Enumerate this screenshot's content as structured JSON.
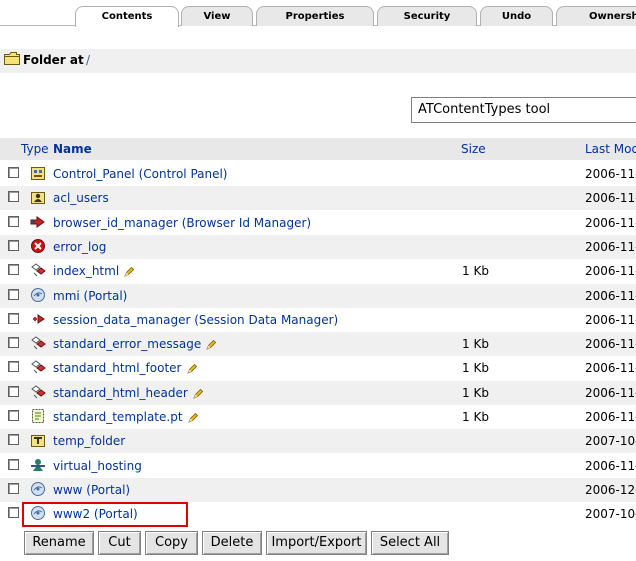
{
  "tabs": [
    {
      "label": "Contents",
      "active": true
    },
    {
      "label": "View"
    },
    {
      "label": "Properties"
    },
    {
      "label": "Security"
    },
    {
      "label": "Undo"
    },
    {
      "label": "Ownership"
    }
  ],
  "header": {
    "folder_label": "Folder at",
    "path": "/"
  },
  "add_type_select": {
    "selected": "ATContentTypes tool"
  },
  "listing": {
    "columns": {
      "type": "Type",
      "name": "Name",
      "size": "Size",
      "modified": "Last Modified"
    },
    "rows": [
      {
        "icon": "control-panel-icon",
        "name": "Control_Panel (Control Panel)",
        "editable": false,
        "size": "",
        "modified": "2006-11-"
      },
      {
        "icon": "user-folder-icon",
        "name": "acl_users",
        "editable": false,
        "size": "",
        "modified": "2006-11-"
      },
      {
        "icon": "browser-id-icon",
        "name": "browser_id_manager (Browser Id Manager)",
        "editable": false,
        "size": "",
        "modified": "2006-11-"
      },
      {
        "icon": "error-log-icon",
        "name": "error_log",
        "editable": false,
        "size": "",
        "modified": "2006-11-"
      },
      {
        "icon": "dtml-method-icon",
        "name": "index_html",
        "editable": true,
        "size": "1 Kb",
        "modified": "2006-11-"
      },
      {
        "icon": "portal-icon",
        "name": "mmi (Portal)",
        "editable": false,
        "size": "",
        "modified": "2006-11-"
      },
      {
        "icon": "session-data-icon",
        "name": "session_data_manager (Session Data Manager)",
        "editable": false,
        "size": "",
        "modified": "2006-11-"
      },
      {
        "icon": "dtml-method-icon",
        "name": "standard_error_message",
        "editable": true,
        "size": "1 Kb",
        "modified": "2006-11-"
      },
      {
        "icon": "dtml-method-icon",
        "name": "standard_html_footer",
        "editable": true,
        "size": "1 Kb",
        "modified": "2006-11-"
      },
      {
        "icon": "dtml-method-icon",
        "name": "standard_html_header",
        "editable": true,
        "size": "1 Kb",
        "modified": "2006-11-"
      },
      {
        "icon": "page-template-icon",
        "name": "standard_template.pt",
        "editable": true,
        "size": "1 Kb",
        "modified": "2006-11-"
      },
      {
        "icon": "temp-folder-icon",
        "name": "temp_folder",
        "editable": false,
        "size": "",
        "modified": "2007-10-"
      },
      {
        "icon": "virtual-hosting-icon",
        "name": "virtual_hosting",
        "editable": false,
        "size": "",
        "modified": "2006-11-"
      },
      {
        "icon": "portal-icon",
        "name": "www (Portal)",
        "editable": false,
        "size": "",
        "modified": "2006-12-"
      },
      {
        "icon": "portal-icon",
        "name": "www2 (Portal)",
        "editable": false,
        "size": "",
        "modified": "2007-10-"
      }
    ]
  },
  "buttons": [
    "Rename",
    "Cut",
    "Copy",
    "Delete",
    "Import/Export",
    "Select All"
  ],
  "colors": {
    "link": "#003399",
    "highlight": "#e00000",
    "row_alt": "#f0f0f0"
  }
}
